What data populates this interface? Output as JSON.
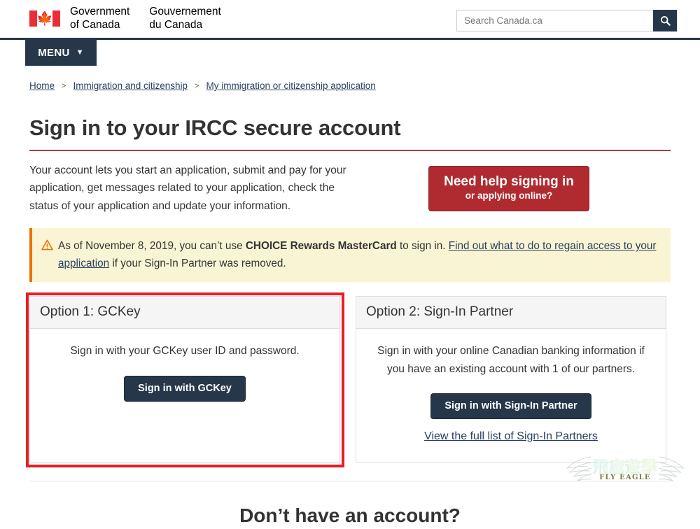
{
  "header": {
    "brand_en_line1": "Government",
    "brand_en_line2": "of Canada",
    "brand_fr_line1": "Gouvernement",
    "brand_fr_line2": "du Canada",
    "flag_icon": "canada-flag-icon",
    "search_placeholder": "Search Canada.ca",
    "search_value": "",
    "search_icon": "search-icon",
    "menu_label": "MENU",
    "menu_caret_icon": "chevron-down-icon"
  },
  "breadcrumb": {
    "items": [
      {
        "label": "Home"
      },
      {
        "label": "Immigration and citizenship"
      },
      {
        "label": "My immigration or citizenship application"
      }
    ],
    "separator": ">"
  },
  "main": {
    "page_title": "Sign in to your IRCC secure account",
    "intro": "Your account lets you start an application, submit and pay for your application, get messages related to your application, check the status of your application and update your information.",
    "help_button": {
      "line1": "Need help signing in",
      "line2": "or applying online?",
      "color": "#b02b30"
    },
    "warning": {
      "icon": "warning-triangle-icon",
      "accent_color": "#ee7100",
      "background_color": "#f9f4d4",
      "text_before": "As of November 8, 2019, you can’t use ",
      "text_bold": "CHOICE Rewards MasterCard",
      "text_middle": " to sign in. ",
      "link_text": "Find out what to do to regain access to your application",
      "text_after": " if your Sign-In Partner was removed."
    },
    "options": [
      {
        "heading": "Option 1: GCKey",
        "description": "Sign in with your GCKey user ID and password.",
        "button_label": "Sign in with GCKey",
        "link_label": "",
        "highlighted": true
      },
      {
        "heading": "Option 2: Sign-In Partner",
        "description": "Sign in with your online Canadian banking information if you have an existing account with 1 of our partners.",
        "button_label": "Sign in with Sign-In Partner",
        "link_label": "View the full list of Sign-In Partners",
        "highlighted": false
      }
    ],
    "bottom_heading": "Don’t have an account?"
  },
  "annotation": {
    "highlight_color": "#ed1c24"
  },
  "watermark": {
    "primary": "飛鷹遊學",
    "secondary": "FLY EAGLE"
  }
}
